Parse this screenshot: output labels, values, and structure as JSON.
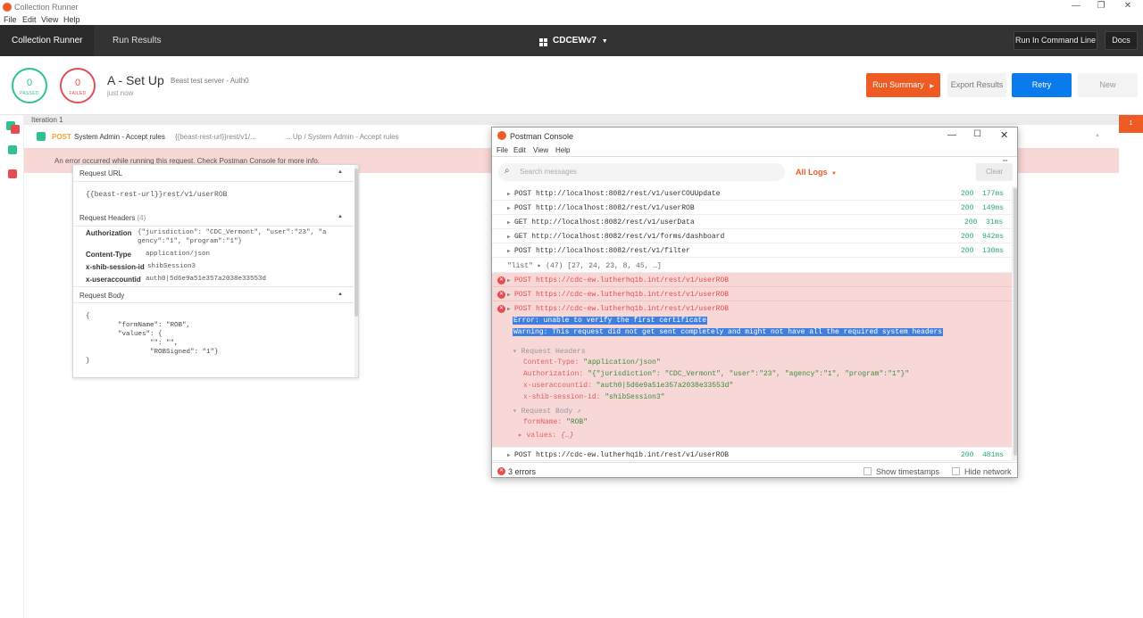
{
  "window": {
    "title": "Collection Runner",
    "menu": [
      "File",
      "Edit",
      "View",
      "Help"
    ],
    "controls": [
      "—",
      "❐",
      "✕"
    ]
  },
  "topnav": {
    "tabs": [
      "Collection Runner",
      "Run Results"
    ],
    "workspace": "CDCEWv7",
    "run_cmd_label": "Run In Command Line",
    "docs_label": "Docs"
  },
  "summary": {
    "passed_count": "0",
    "passed_label": "PASSED",
    "failed_count": "0",
    "failed_label": "FAILED",
    "collection_name": "A - Set Up",
    "environment": "Beast test server - Auth0",
    "time": "just now",
    "run_summary_label": "Run Summary",
    "export_label": "Export Results",
    "retry_label": "Retry",
    "new_label": "New"
  },
  "iteration": {
    "label": "Iteration 1",
    "badge": "1",
    "request": {
      "method": "POST",
      "name": "System Admin - Accept rules",
      "url": "{{beast-rest-url}}rest/v1/...",
      "path": "... Up / System Admin - Accept rules"
    },
    "error_text": "An error occurred while running this request. Check Postman Console for more info."
  },
  "detail": {
    "url_title": "Request URL",
    "url_value": "{{beast-rest-url}}rest/v1/userROB",
    "headers_title": "Request Headers",
    "headers_count": "(4)",
    "headers": [
      {
        "key": "Authorization",
        "value": "{\"jurisdiction\": \"CDC_Vermont\", \"user\":\"23\", \"a",
        "value2": "gency\":\"1\", \"program\":\"1\"}"
      },
      {
        "key": "Content-Type",
        "value": "application/json",
        "value2": ""
      },
      {
        "key": "x-shib-session-id",
        "value": "shibSession3",
        "value2": ""
      },
      {
        "key": "x-useraccountid",
        "value": "auth0|5d6e9a51e357a2038e33553d",
        "value2": ""
      }
    ],
    "body_title": "Request Body",
    "body_lines": [
      "{",
      "        \"formName\": \"ROB\",",
      "        \"values\": {",
      "                \"\": \"\",",
      "                \"ROBSigned\": \"1\"}",
      "}"
    ]
  },
  "console": {
    "title": "Postman Console",
    "menu": [
      "File",
      "Edit",
      "View",
      "Help"
    ],
    "search_placeholder": "Search messages",
    "filter": "All Logs",
    "clear_label": "Clear",
    "rows": [
      {
        "text": "POST http://localhost:8082/rest/v1/userCOUUpdate",
        "status": "200",
        "time": "177ms"
      },
      {
        "text": "POST http://localhost:8082/rest/v1/userROB",
        "status": "200",
        "time": "149ms"
      },
      {
        "text": "GET http://localhost:8082/rest/v1/userData",
        "status": "200",
        "time": "31ms"
      },
      {
        "text": "GET http://localhost:8082/rest/v1/forms/dashboard",
        "status": "200",
        "time": "942ms"
      },
      {
        "text": "POST http://localhost:8082/rest/v1/filter",
        "status": "200",
        "time": "130ms"
      }
    ],
    "list_log": "\"list\"  ▸ (47) [27, 24, 23, 8, 45, …]",
    "error_rows": [
      "POST https://cdc-ew.lutherhq1b.int/rest/v1/userROB",
      "POST https://cdc-ew.lutherhq1b.int/rest/v1/userROB",
      "POST https://cdc-ew.lutherhq1b.int/rest/v1/userROB"
    ],
    "error_msg": "Error: unable to verify the first certificate",
    "warning_msg": "Warning: This request did not get sent completely and might not have all the required system headers",
    "req_headers_label": "▾ Request Headers",
    "req_headers": [
      {
        "key": "Content-Type:",
        "value": "\"application/json\""
      },
      {
        "key": "Authorization:",
        "value": "\"{\"jurisdiction\": \"CDC_Vermont\", \"user\":\"23\", \"agency\":\"1\", \"program\":\"1\"}\""
      },
      {
        "key": "x-useraccountid:",
        "value": "\"auth0|5d6e9a51e357a2038e33553d\""
      },
      {
        "key": "x-shib-session-id:",
        "value": "\"shibSession3\""
      }
    ],
    "req_body_label": "▾ Request Body",
    "form_name_key": "formName:",
    "form_name_val": "\"ROB\"",
    "values_key": "▸ values:",
    "values_val": "{…}",
    "last_row": {
      "text": "POST https://cdc-ew.lutherhq1b.int/rest/v1/userROB",
      "status": "200",
      "time": "481ms"
    },
    "errors_count": "3 errors",
    "show_timestamps": "Show timestamps",
    "hide_network": "Hide network"
  }
}
